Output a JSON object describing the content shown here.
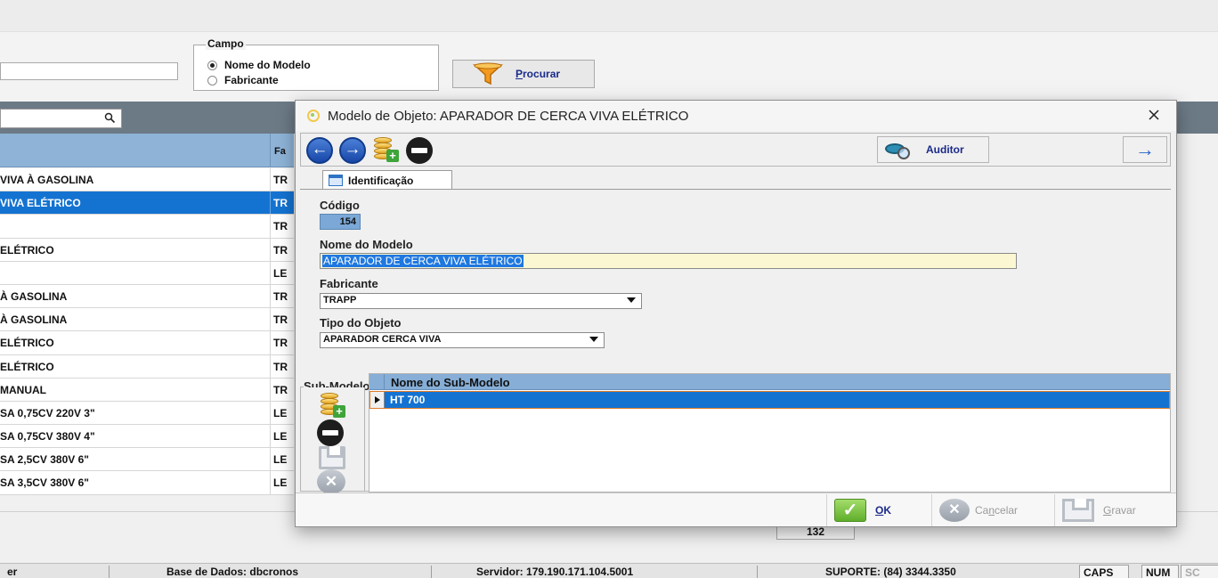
{
  "background": {
    "campo": {
      "legend": "Campo",
      "options": [
        "Nome do Modelo",
        "Fabricante"
      ],
      "selected": "Nome do Modelo"
    },
    "search_button": {
      "accel": "P",
      "rest": "rocurar"
    },
    "grid": {
      "col2_header": "Fa",
      "rows": [
        {
          "c1": "VIVA À GASOLINA",
          "c2": "TR"
        },
        {
          "c1": "VIVA ELÉTRICO",
          "c2": "TR",
          "selected": true
        },
        {
          "c1": "",
          "c2": "TR"
        },
        {
          "c1": "ELÉTRICO",
          "c2": "TR"
        },
        {
          "c1": "",
          "c2": "LE"
        },
        {
          "c1": "À GASOLINA",
          "c2": "TR"
        },
        {
          "c1": "À GASOLINA",
          "c2": "TR"
        },
        {
          "c1": "ELÉTRICO",
          "c2": "TR"
        },
        {
          "c1": "ELÉTRICO",
          "c2": "TR"
        },
        {
          "c1": "MANUAL",
          "c2": "TR"
        },
        {
          "c1": "SA  0,75CV 220V 3\"",
          "c2": "LE"
        },
        {
          "c1": "SA  0,75CV 380V 4\"",
          "c2": "LE"
        },
        {
          "c1": "SA  2,5CV 380V 6\"",
          "c2": "LE"
        },
        {
          "c1": "SA  3,5CV 380V 6\"",
          "c2": "LE"
        }
      ],
      "record_count": "132"
    },
    "statusbar": {
      "user": "er",
      "database": "Base de Dados: dbcronos",
      "server": "Servidor: 179.190.171.104.5001",
      "support": "SUPORTE: (84) 3344.3350",
      "caps": "CAPS",
      "num": "NUM",
      "scroll": "SC"
    }
  },
  "dialog": {
    "title": "Modelo de Objeto: APARADOR DE CERCA VIVA ELÉTRICO",
    "toolbar": {
      "auditor_label": "Auditor"
    },
    "tab": "Identificação",
    "codigo_label": "Código",
    "codigo_value": "154",
    "nome_label": "Nome do Modelo",
    "nome_value": "APARADOR DE CERCA VIVA ELÉTRICO",
    "fabricante_label": "Fabricante",
    "fabricante_value": "TRAPP",
    "tipo_label": "Tipo do Objeto",
    "tipo_value": "APARADOR CERCA VIVA",
    "submodelos": {
      "legend": "Sub-Modelos",
      "column": "Nome do Sub-Modelo",
      "rows": [
        "HT 700"
      ]
    },
    "footer": {
      "ok": {
        "accel": "O",
        "rest": "K"
      },
      "cancel": {
        "pre": "Ca",
        "accel": "n",
        "rest": "celar"
      },
      "save": {
        "accel": "G",
        "rest": "ravar"
      }
    }
  }
}
